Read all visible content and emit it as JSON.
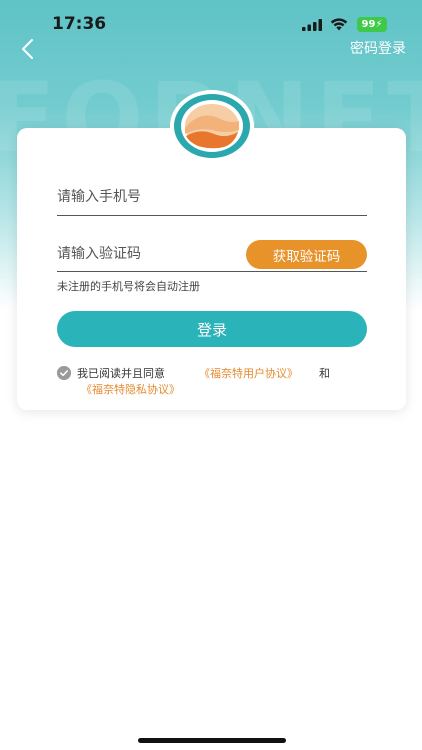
{
  "status_bar": {
    "time": "17:36",
    "battery": "99"
  },
  "nav": {
    "back_icon": "chevron-left-icon",
    "right_label": "密码登录"
  },
  "form": {
    "phone_placeholder": "请输入手机号",
    "code_placeholder": "请输入验证码",
    "get_code_label": "获取验证码",
    "hint": "未注册的手机号将会自动注册",
    "login_label": "登录"
  },
  "agreement": {
    "prefix": "我已阅读并且同意",
    "user_agreement": "《福奈特用户协议》",
    "and": "和",
    "privacy_agreement": "《福奈特隐私协议》"
  },
  "colors": {
    "brand_teal": "#2ab3b8",
    "accent_orange": "#e8922a",
    "link_orange": "#e58a2e"
  }
}
